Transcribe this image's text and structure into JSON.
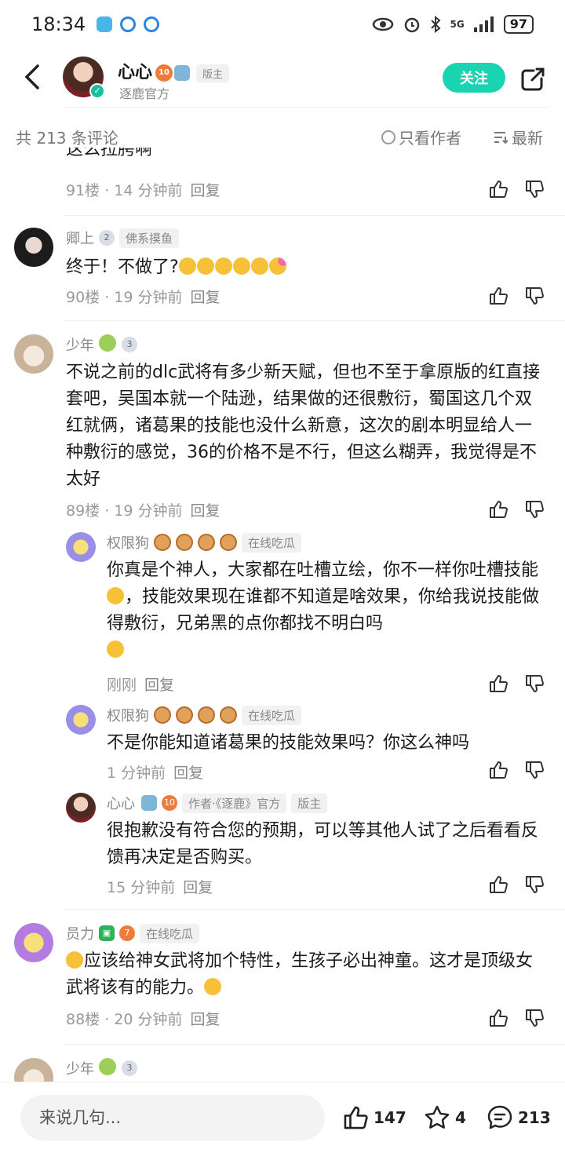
{
  "status": {
    "time": "18:34",
    "battery": "97",
    "network": "5G"
  },
  "header": {
    "author_name": "心心",
    "author_level": "10",
    "author_role": "版主",
    "author_subtitle": "逐鹿官方",
    "follow_label": "关注"
  },
  "filter": {
    "count_text": "共 213 条评论",
    "only_author": "只看作者",
    "sort": "最新"
  },
  "comments": {
    "c0": {
      "meta": "91楼 · 14 分钟前",
      "reply": "回复"
    },
    "c1": {
      "name": "卿上",
      "level": "2",
      "tag": "佛系摸鱼",
      "text": "终于！不做了?",
      "meta": "90楼 · 19 分钟前",
      "reply": "回复"
    },
    "c2": {
      "name": "少年",
      "level": "3",
      "text": "不说之前的dlc武将有多少新天赋，但也不至于拿原版的红直接套吧，吴国本就一个陆逊，结果做的还很敷衍，蜀国这几个双红就俩，诸葛果的技能也没什么新意，这次的剧本明显给人一种敷衍的感觉，36的价格不是不行，但这么糊弄，我觉得是不太好",
      "meta": "89楼 · 19 分钟前",
      "reply": "回复"
    },
    "r1": {
      "name": "权限狗",
      "tag": "在线吃瓜",
      "text_a": "你真是个神人，大家都在吐槽立绘，你不一样你吐槽技能",
      "text_b": "，技能效果现在谁都不知道是啥效果，你给我说技能做得敷衍，兄弟黑的点你都找不明白吗",
      "meta": "刚刚",
      "reply": "回复"
    },
    "r2": {
      "name": "权限狗",
      "tag": "在线吃瓜",
      "text": "不是你能知道诸葛果的技能效果吗？你这么神吗",
      "meta": "1 分钟前",
      "reply": "回复"
    },
    "r3": {
      "name": "心心",
      "level": "10",
      "tag_author": "作者·《逐鹿》官方",
      "tag_mod": "版主",
      "text": "很抱歉没有符合您的预期，可以等其他人试了之后看看反馈再决定是否购买。",
      "meta": "15 分钟前",
      "reply": "回复"
    },
    "c3": {
      "name": "员力",
      "level": "7",
      "tag": "在线吃瓜",
      "text_a": "应该给神女武将加个特性，生孩子必出神童。这才是顶级女武将该有的能力。",
      "meta": "88楼 · 20 分钟前",
      "reply": "回复"
    },
    "c4": {
      "name": "少年",
      "level": "3"
    }
  },
  "bottom": {
    "input_placeholder": "来说几句...",
    "likes": "147",
    "stars": "4",
    "comments": "213"
  },
  "colors": {
    "accent": "#1ad3b0",
    "level_orange": "#ef7b3a"
  }
}
